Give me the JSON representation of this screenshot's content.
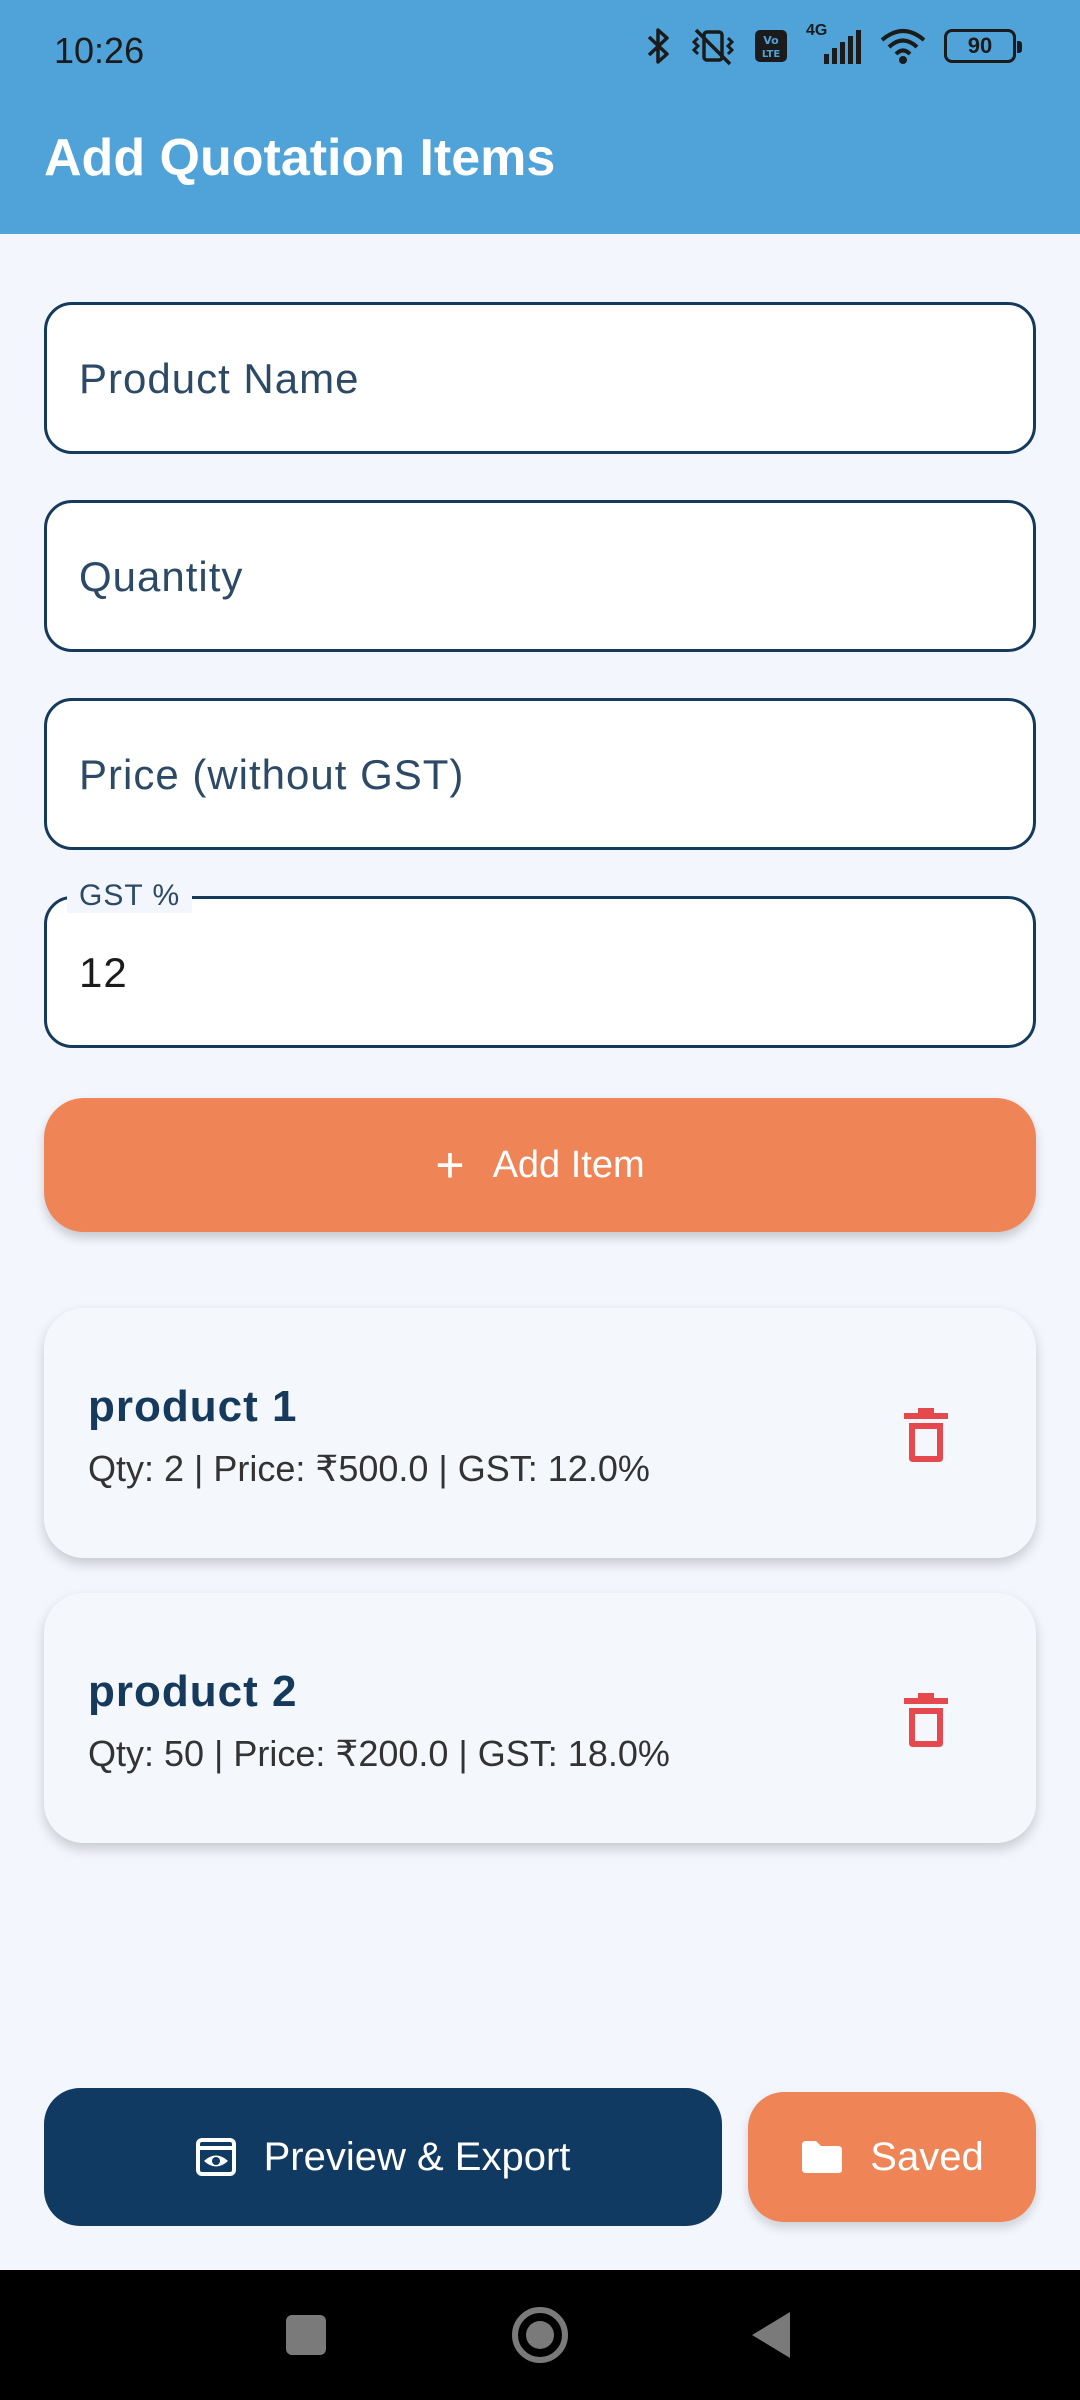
{
  "status_bar": {
    "time": "10:26",
    "battery": "90",
    "network_label": "4G",
    "icons": [
      "bluetooth-icon",
      "vibrate-mute-icon",
      "volte-icon",
      "signal-icon",
      "wifi-icon",
      "battery-icon"
    ]
  },
  "app_bar": {
    "title": "Add Quotation Items",
    "color": "#4fa3d8"
  },
  "form": {
    "product_name": {
      "placeholder": "Product Name",
      "value": ""
    },
    "quantity": {
      "placeholder": "Quantity",
      "value": ""
    },
    "price": {
      "placeholder": "Price (without GST)",
      "value": ""
    },
    "gst": {
      "label": "GST %",
      "value": "12"
    }
  },
  "add_button": {
    "icon": "plus-icon",
    "label": "Add Item",
    "color": "#ef8557"
  },
  "items": [
    {
      "name": "product 1",
      "detail": "Qty: 2 | Price: ₹500.0 | GST: 12.0%"
    },
    {
      "name": "product 2",
      "detail": "Qty: 50 | Price: ₹200.0 | GST: 18.0%"
    }
  ],
  "actions": {
    "preview_export": {
      "icon": "preview-icon",
      "label": "Preview & Export",
      "color": "#113a63"
    },
    "saved": {
      "icon": "folder-icon",
      "label": "Saved",
      "color": "#ef8557"
    }
  },
  "delete_color": "#e5484d"
}
